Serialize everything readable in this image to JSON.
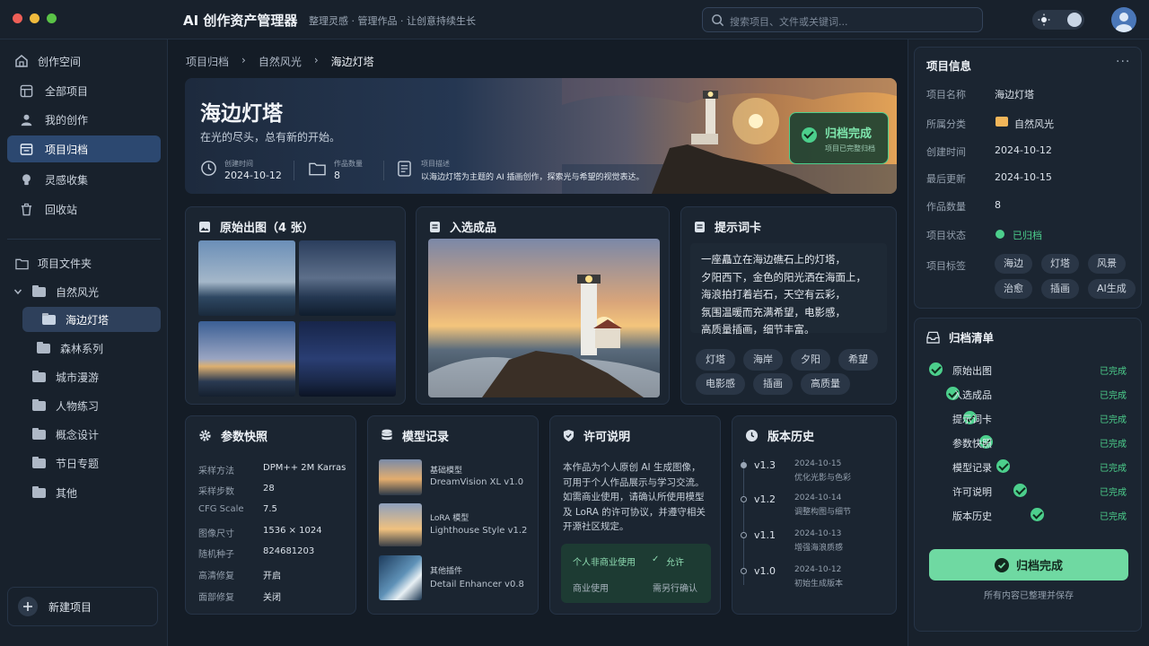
{
  "window": {
    "title": "AI 创作资产管理器",
    "subtitle": "整理灵感 · 管理作品 · 让创意持续生长"
  },
  "search": {
    "placeholder": "搜索项目、文件或关键词..."
  },
  "sidebar": {
    "nav": [
      {
        "label": "创作空间",
        "icon": "home-icon"
      },
      {
        "label": "全部项目",
        "icon": "grid-icon"
      },
      {
        "label": "我的创作",
        "icon": "user-icon"
      },
      {
        "label": "项目归档",
        "icon": "archive-icon"
      },
      {
        "label": "灵感收集",
        "icon": "bulb-icon"
      },
      {
        "label": "回收站",
        "icon": "trash-icon"
      }
    ],
    "folders_title": "项目文件夹",
    "folders": [
      "自然风光",
      "海边灯塔",
      "森林系列",
      "城市漫游",
      "人物练习",
      "概念设计",
      "节日专题",
      "其他"
    ],
    "new_project": "新建项目"
  },
  "breadcrumb": [
    "项目归档",
    "自然风光",
    "海边灯塔"
  ],
  "hero": {
    "title": "海边灯塔",
    "tagline": "在光的尽头，总有新的开始。",
    "created_label": "创建时间",
    "created": "2024-10-12",
    "count_label": "作品数量",
    "count": "8",
    "desc_label": "项目描述",
    "desc": "以海边灯塔为主题的 AI 插画创作，探索光与希望的视觉表达。",
    "badge_title": "归档完成",
    "badge_sub": "项目已完整归档"
  },
  "originals": {
    "title": "原始出图（4 张）"
  },
  "selected": {
    "title": "入选成品"
  },
  "prompt": {
    "title": "提示词卡",
    "lines": [
      "一座矗立在海边礁石上的灯塔，",
      "夕阳西下，金色的阳光洒在海面上，",
      "海浪拍打着岩石，天空有云彩，",
      "氛围温暖而充满希望，电影感，",
      "高质量插画，细节丰富。"
    ],
    "tags": [
      "灯塔",
      "海岸",
      "夕阳",
      "希望",
      "电影感",
      "插画",
      "高质量"
    ]
  },
  "params": {
    "title": "参数快照",
    "rows": [
      {
        "k": "采样方法",
        "v": "DPM++ 2M Karras"
      },
      {
        "k": "采样步数",
        "v": "28"
      },
      {
        "k": "CFG Scale",
        "v": "7.5"
      },
      {
        "k": "图像尺寸",
        "v": "1536 × 1024"
      },
      {
        "k": "随机种子",
        "v": "824681203"
      },
      {
        "k": "高清修复",
        "v": "开启"
      },
      {
        "k": "面部修复",
        "v": "关闭"
      }
    ]
  },
  "models": {
    "title": "模型记录",
    "items": [
      {
        "k": "基础模型",
        "v": "DreamVision XL v1.0"
      },
      {
        "k": "LoRA 模型",
        "v": "Lighthouse Style v1.2"
      },
      {
        "k": "其他插件",
        "v": "Detail Enhancer v0.8"
      }
    ]
  },
  "license": {
    "title": "许可说明",
    "lines": [
      "本作品为个人原创 AI 生成图像，",
      "可用于个人作品展示与学习交流。",
      "如需商业使用，请确认所使用模型",
      "及 LoRA 的许可协议，并遵守相关",
      "开源社区规定。"
    ],
    "personal": "个人非商业使用",
    "personal_v": "允许",
    "commercial": "商业使用",
    "commercial_v": "需另行确认"
  },
  "history": {
    "title": "版本历史",
    "items": [
      {
        "ver": "v1.3",
        "date": "2024-10-15",
        "note": "优化光影与色彩"
      },
      {
        "ver": "v1.2",
        "date": "2024-10-14",
        "note": "调整构图与细节"
      },
      {
        "ver": "v1.1",
        "date": "2024-10-13",
        "note": "增强海浪质感"
      },
      {
        "ver": "v1.0",
        "date": "2024-10-12",
        "note": "初始生成版本"
      }
    ]
  },
  "info": {
    "title": "项目信息",
    "rows": [
      {
        "k": "项目名称",
        "v": "海边灯塔"
      },
      {
        "k": "所属分类",
        "v": "自然风光"
      },
      {
        "k": "创建时间",
        "v": "2024-10-12"
      },
      {
        "k": "最后更新",
        "v": "2024-10-15"
      },
      {
        "k": "作品数量",
        "v": "8"
      },
      {
        "k": "项目状态",
        "v": "已归档"
      }
    ],
    "tags_label": "项目标签",
    "tags": [
      "海边",
      "灯塔",
      "风景",
      "治愈",
      "插画",
      "AI生成"
    ]
  },
  "checklist": {
    "title": "归档清单",
    "items": [
      "原始出图",
      "入选成品",
      "提示词卡",
      "参数快照",
      "模型记录",
      "许可说明",
      "版本历史"
    ],
    "status": "已完成",
    "button": "归档完成",
    "footer": "所有内容已整理并保存"
  },
  "colors": {
    "accent": "#4ccf8c",
    "active": "#2c4870",
    "bg": "#141c26"
  }
}
